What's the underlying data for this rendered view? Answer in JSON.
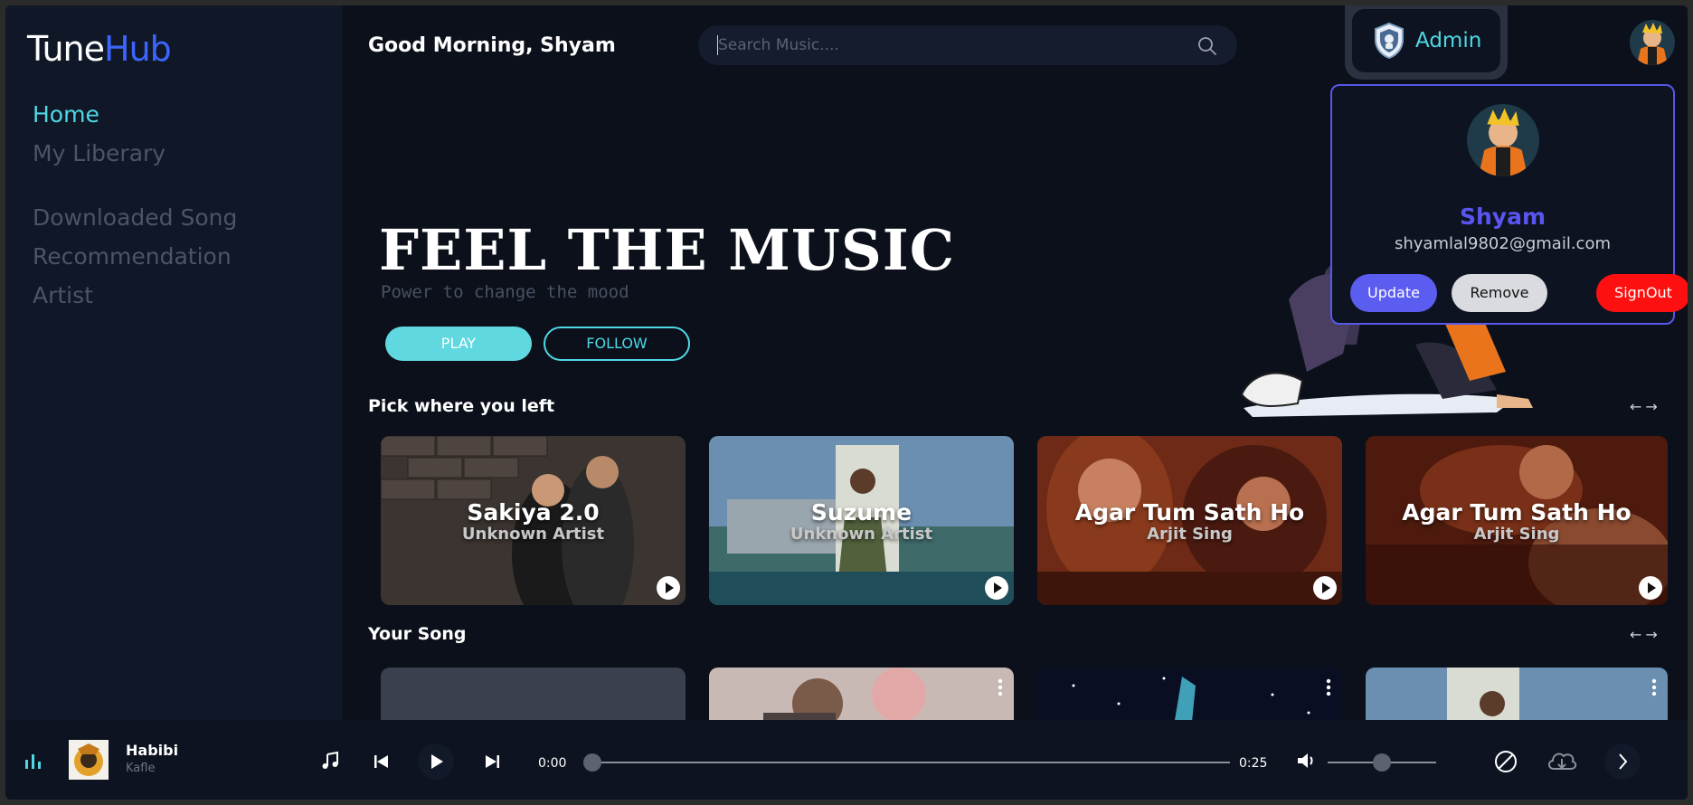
{
  "brand": {
    "part1": "Tune",
    "part2": "Hub"
  },
  "sidebar": {
    "items": [
      {
        "label": "Home",
        "active": true
      },
      {
        "label": "My Liberary"
      },
      {
        "label": "Downloaded Song"
      },
      {
        "label": "Recommendation"
      },
      {
        "label": "Artist"
      }
    ]
  },
  "header": {
    "greeting": "Good Morning, Shyam",
    "search_placeholder": "Search Music....",
    "admin_label": "Admin"
  },
  "hero": {
    "title": "FEEL THE MUSIC",
    "subtitle": "Power to change the mood",
    "play_label": "PLAY",
    "follow_label": "FOLLOW"
  },
  "sections": {
    "pick": "Pick where you left",
    "your_song": "Your Song",
    "arrows": "←→"
  },
  "recent": [
    {
      "title": "Sakiya 2.0",
      "artist": "Unknown Artist"
    },
    {
      "title": "Suzume",
      "artist": "Unknown Artist"
    },
    {
      "title": "Agar Tum Sath Ho",
      "artist": "Arjit Sing"
    },
    {
      "title": "Agar Tum Sath Ho",
      "artist": "Arjit Sing"
    }
  ],
  "profile": {
    "name": "Shyam",
    "email": "shyamlal9802@gmail.com",
    "update_label": "Update",
    "remove_label": "Remove",
    "signout_label": "SignOut"
  },
  "player": {
    "title": "Habibi",
    "artist": "Kafle",
    "current_time": "0:00",
    "duration": "0:25",
    "progress": 0.0,
    "volume": 0.5
  },
  "colors": {
    "accent": "#4fd8e4",
    "brand_blue": "#3d64ff",
    "profile_name": "#5a55f0",
    "signout": "#ff1010"
  }
}
